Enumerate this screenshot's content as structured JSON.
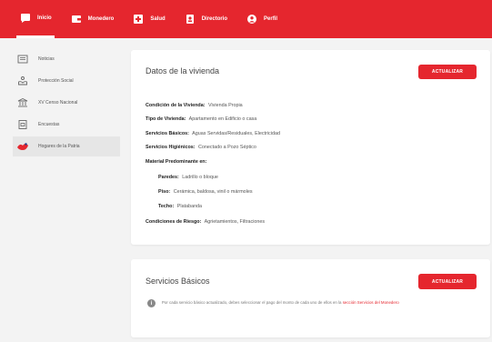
{
  "topnav": {
    "items": [
      {
        "label": "Inicio",
        "icon": "chat-bubble-icon"
      },
      {
        "label": "Monedero",
        "icon": "wallet-icon"
      },
      {
        "label": "Salud",
        "icon": "medical-cross-icon"
      },
      {
        "label": "Directorio",
        "icon": "contact-book-icon"
      },
      {
        "label": "Perfil",
        "icon": "user-icon"
      }
    ]
  },
  "sidebar": {
    "items": [
      {
        "label": "Noticias",
        "icon": "newspaper-icon"
      },
      {
        "label": "Protección Social",
        "icon": "hand-heart-icon"
      },
      {
        "label": "XV Censo Nacional",
        "icon": "building-icon"
      },
      {
        "label": "Encuestas",
        "icon": "survey-icon"
      },
      {
        "label": "Hogares de la Patria",
        "icon": "hogares-logo-icon"
      }
    ]
  },
  "vivienda": {
    "title": "Datos de la vivienda",
    "button": "ACTUALIZAR",
    "condicion": {
      "label": "Condición de la Vivienda:",
      "value": "Vivienda Propia"
    },
    "tipo": {
      "label": "Tipo de Vivienda:",
      "value": "Apartamento en Edificio o casa"
    },
    "servicios_basicos": {
      "label": "Servicios Básicos:",
      "value": "Aguas Servidas/Residuales, Electricidad"
    },
    "servicios_higienicos": {
      "label": "Servicios Higiénicos:",
      "value": "Conectado a Pozo Séptico"
    },
    "material": {
      "label": "Material Predominante en:"
    },
    "paredes": {
      "label": "Paredes:",
      "value": "Ladrillo o bloque"
    },
    "piso": {
      "label": "Piso:",
      "value": "Cerámica, baldosa, vinil o mármoles"
    },
    "techo": {
      "label": "Techo:",
      "value": "Platabanda"
    },
    "riesgo": {
      "label": "Condiciones de Riesgo:",
      "value": "Agrietamientos, Filtraciones"
    }
  },
  "servicios": {
    "title": "Servicios Básicos",
    "button": "ACTUALIZAR",
    "info_text": "Por cada servicio básico actualizado, debes seleccionar el pago del monto de cada uno de ellos en la",
    "info_link": "sección Servicios del Monedero",
    "info_icon": "info-icon"
  },
  "colors": {
    "accent": "#e5262e",
    "background": "#f3f3f3"
  }
}
